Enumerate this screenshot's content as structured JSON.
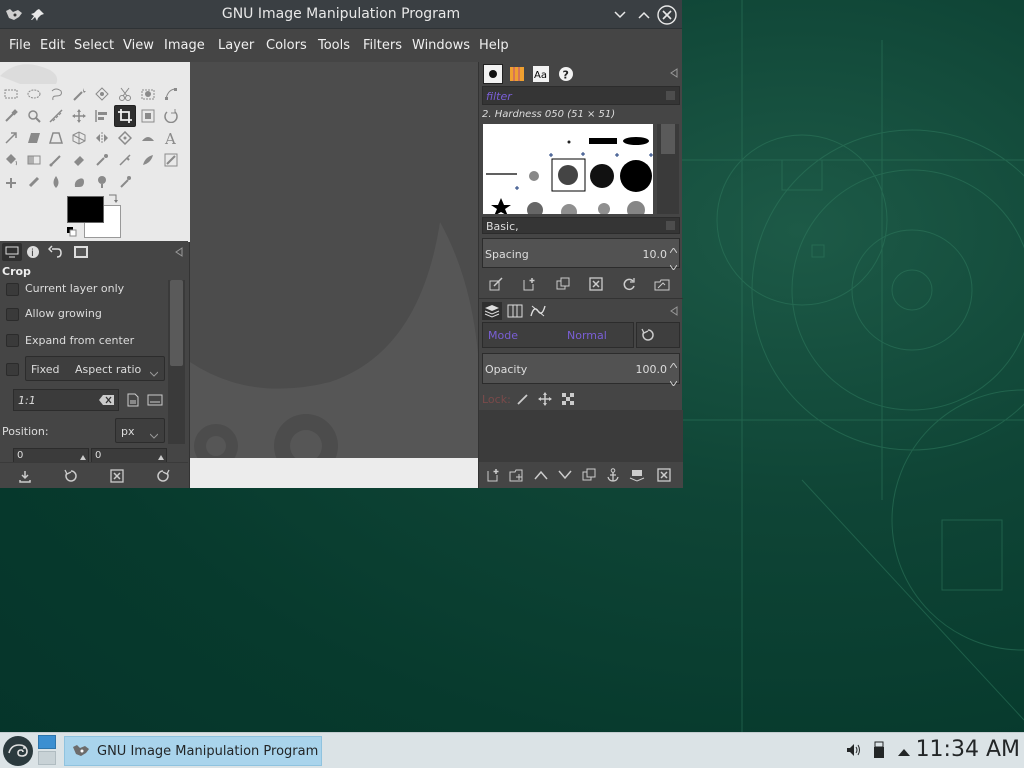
{
  "window": {
    "title": "GNU Image Manipulation Program"
  },
  "menu": [
    "File",
    "Edit",
    "Select",
    "View",
    "Image",
    "Layer",
    "Colors",
    "Tools",
    "Filters",
    "Windows",
    "Help"
  ],
  "tool_options": {
    "title": "Crop",
    "current_layer_only": "Current layer only",
    "allow_growing": "Allow growing",
    "expand_from_center": "Expand from center",
    "fixed": "Fixed",
    "fixed_mode": "Aspect ratio",
    "ratio_value": "1:1",
    "position_label": "Position:",
    "unit": "px",
    "pos_x": "0",
    "pos_y": "0"
  },
  "brushes": {
    "filter_placeholder": "filter",
    "selected": "2. Hardness 050 (51 × 51)",
    "tag": "Basic,",
    "spacing_label": "Spacing",
    "spacing_value": "10.0"
  },
  "layers": {
    "mode_label": "Mode",
    "mode_value": "Normal",
    "opacity_label": "Opacity",
    "opacity_value": "100.0",
    "lock_label": "Lock:"
  },
  "taskbar": {
    "task_title": "GNU Image Manipulation Program",
    "clock": "11:34 AM"
  },
  "colors": {
    "accent": "#7a5fd6",
    "desktop": "#0b3f31",
    "panel": "#454545"
  }
}
